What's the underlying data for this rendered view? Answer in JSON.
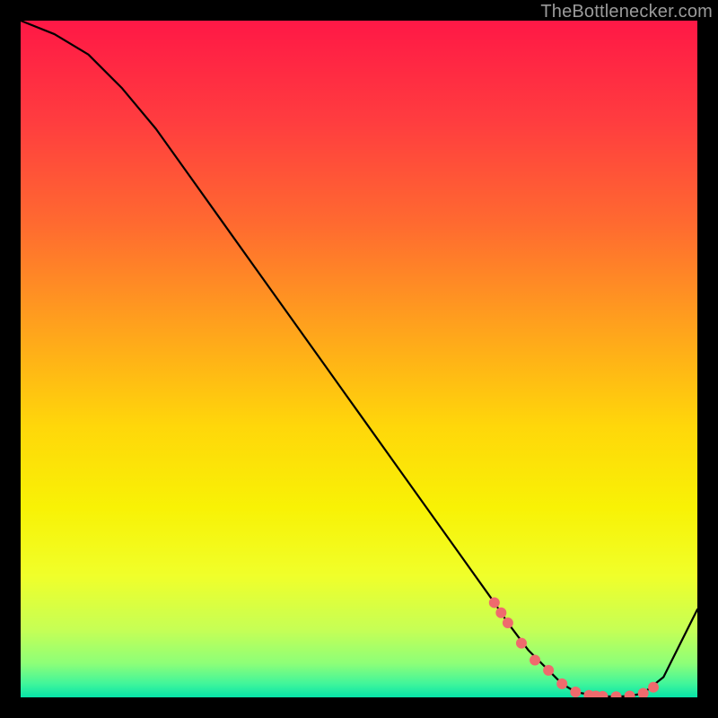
{
  "watermark": "TheBottlenecker.com",
  "chart_data": {
    "type": "line",
    "title": "",
    "xlabel": "",
    "ylabel": "",
    "xlim": [
      0,
      100
    ],
    "ylim": [
      0,
      100
    ],
    "grid": false,
    "legend": false,
    "background_gradient": [
      {
        "offset": 0.0,
        "color": "#ff1846"
      },
      {
        "offset": 0.15,
        "color": "#ff3d3f"
      },
      {
        "offset": 0.3,
        "color": "#ff6a30"
      },
      {
        "offset": 0.45,
        "color": "#ffa11d"
      },
      {
        "offset": 0.6,
        "color": "#ffd70a"
      },
      {
        "offset": 0.72,
        "color": "#f8f205"
      },
      {
        "offset": 0.82,
        "color": "#f0ff2a"
      },
      {
        "offset": 0.9,
        "color": "#c6ff55"
      },
      {
        "offset": 0.95,
        "color": "#8dff78"
      },
      {
        "offset": 0.98,
        "color": "#40f59b"
      },
      {
        "offset": 1.0,
        "color": "#06e3a8"
      }
    ],
    "series": [
      {
        "name": "bottleneck-curve",
        "type": "line",
        "color": "#000000",
        "x": [
          0,
          5,
          10,
          15,
          20,
          25,
          30,
          35,
          40,
          45,
          50,
          55,
          60,
          65,
          70,
          72,
          75,
          78,
          80,
          82,
          85,
          88,
          90,
          92,
          95,
          100
        ],
        "values": [
          100,
          98,
          95,
          90,
          84,
          77,
          70,
          63,
          56,
          49,
          42,
          35,
          28,
          21,
          14,
          11,
          7,
          4,
          2,
          0.8,
          0.2,
          0.1,
          0.2,
          0.6,
          3,
          13
        ]
      },
      {
        "name": "marker-dots",
        "type": "scatter",
        "color": "#ef6a6d",
        "x": [
          70.0,
          71.0,
          72.0,
          74.0,
          76.0,
          78.0,
          80.0,
          82.0,
          84.0,
          85.0,
          86.0,
          88.0,
          90.0,
          92.0,
          93.5
        ],
        "values": [
          14.0,
          12.5,
          11.0,
          8.0,
          5.5,
          4.0,
          2.0,
          0.8,
          0.3,
          0.2,
          0.15,
          0.1,
          0.2,
          0.6,
          1.5
        ]
      }
    ]
  }
}
